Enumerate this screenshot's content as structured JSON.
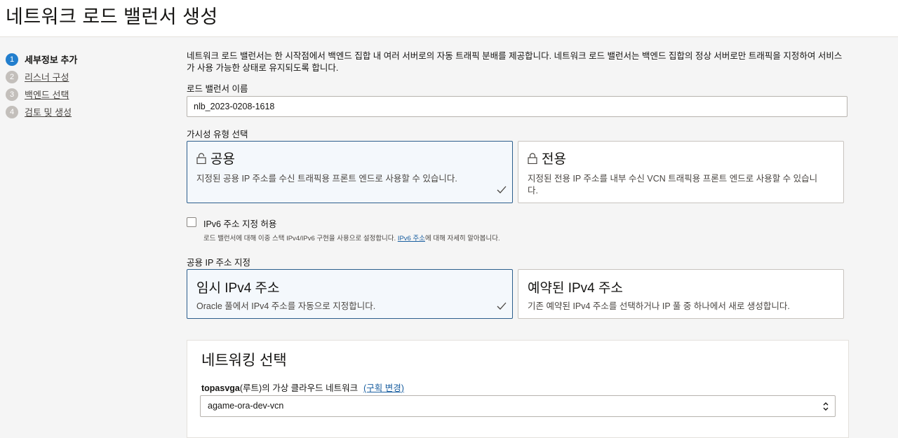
{
  "page": {
    "title": "네트워크 로드 밸런서 생성"
  },
  "steps": [
    {
      "num": "1",
      "label": "세부정보 추가"
    },
    {
      "num": "2",
      "label": "리스너 구성"
    },
    {
      "num": "3",
      "label": "백엔드 선택"
    },
    {
      "num": "4",
      "label": "검토 및 생성"
    }
  ],
  "intro": "네트워크 로드 밸런서는 한 시작점에서 백엔드 집합 내 여러 서버로의 자동 트래픽 분배를 제공합니다. 네트워크 로드 밸런서는 백엔드 집합의 정상 서버로만 트래픽을 지정하여 서비스가 사용 가능한 상태로 유지되도록 합니다.",
  "name_field": {
    "label": "로드 밸런서 이름",
    "value": "nlb_2023-0208-1618"
  },
  "visibility": {
    "label": "가시성 유형 선택",
    "options": [
      {
        "title": "공용",
        "desc": "지정된 공용 IP 주소를 수신 트래픽용 프론트 엔드로 사용할 수 있습니다.",
        "selected": true
      },
      {
        "title": "전용",
        "desc": "지정된 전용 IP 주소를 내부 수신 VCN 트래픽용 프론트 엔드로 사용할 수 있습니다.",
        "selected": false
      }
    ]
  },
  "ipv6": {
    "label": "IPv6 주소 지정 허용",
    "checked": false,
    "help_prefix": "로드 밸런서에 대해 이중 스택 IPv4/IPv6 구현을 사용으로 설정합니다. ",
    "help_link": "IPv6 주소",
    "help_suffix": "에 대해 자세히 알아봅니다."
  },
  "public_ip": {
    "label": "공용 IP 주소 지정",
    "options": [
      {
        "title": "임시 IPv4 주소",
        "desc": "Oracle 풀에서 IPv4 주소를 자동으로 지정합니다.",
        "selected": true
      },
      {
        "title": "예약된 IPv4 주소",
        "desc": "기존 예약된 IPv4 주소를 선택하거나 IP 풀 중 하나에서 새로 생성합니다.",
        "selected": false
      }
    ]
  },
  "networking": {
    "title": "네트워킹 선택",
    "compartment_name": "topasvga",
    "compartment_suffix": "(루트)의 가상 클라우드 네트워크",
    "change_link": "(구획 변경)",
    "vcn_value": "agame-ora-dev-vcn"
  },
  "colors": {
    "accent": "#227ecd",
    "selected_border": "#2c5e8c",
    "link": "#1a5fa0"
  }
}
